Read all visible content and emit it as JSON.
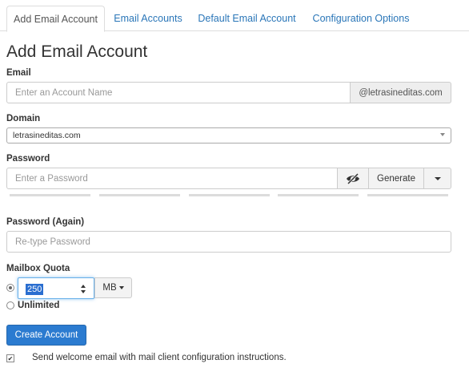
{
  "tabs": {
    "add_email": "Add Email Account",
    "email_accounts": "Email Accounts",
    "default_email": "Default Email Account",
    "config_options": "Configuration Options"
  },
  "form": {
    "title": "Add Email Account",
    "email_label": "Email",
    "email_placeholder": "Enter an Account Name",
    "email_domain_suffix": "@letrasineditas.com",
    "domain_label": "Domain",
    "domain_value": "letrasineditas.com",
    "password_label": "Password",
    "password_placeholder": "Enter a Password",
    "generate_label": "Generate",
    "password_again_label": "Password (Again)",
    "password_again_placeholder": "Re-type Password",
    "quota_label": "Mailbox Quota",
    "quota_value": "250",
    "quota_unit": "MB",
    "unlimited_label": "Unlimited",
    "create_button": "Create Account",
    "welcome_email_label": "Send welcome email with mail client configuration instructions."
  },
  "icons": {
    "toggle_visibility": "eye-slash-icon",
    "generate_options": "caret-down-icon"
  },
  "colors": {
    "accent": "#2b7bd0",
    "tab_link": "#2a76b8",
    "selection": "#2a6ed0"
  }
}
